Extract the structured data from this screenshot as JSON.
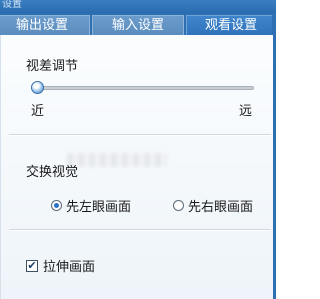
{
  "window": {
    "title": "设置"
  },
  "tabs": [
    {
      "label": "输出设置",
      "active": false
    },
    {
      "label": "输入设置",
      "active": false
    },
    {
      "label": "观看设置",
      "active": true
    }
  ],
  "parallax": {
    "label": "视差调节",
    "min_label": "近",
    "max_label": "远",
    "value_fraction": 0.0
  },
  "swap_view": {
    "label": "交换视觉",
    "options": [
      {
        "label": "先左眼画面",
        "selected": true
      },
      {
        "label": "先右眼画面",
        "selected": false
      }
    ]
  },
  "stretch": {
    "label": "拉伸画面",
    "checked": true,
    "check_glyph": "✔"
  },
  "colors": {
    "accent": "#2d6fb2",
    "panel_bg": "#eef4f9"
  }
}
